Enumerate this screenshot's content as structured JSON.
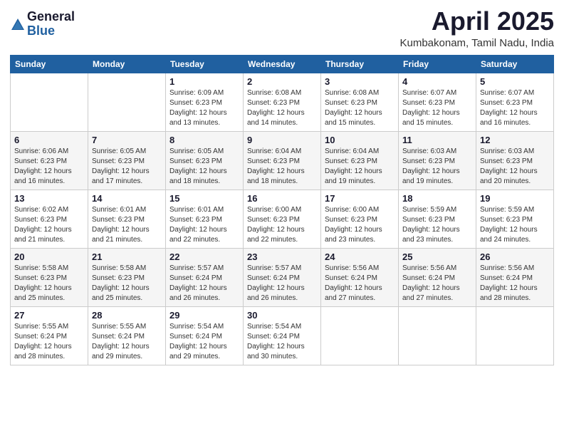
{
  "logo": {
    "general": "General",
    "blue": "Blue"
  },
  "title": "April 2025",
  "subtitle": "Kumbakonam, Tamil Nadu, India",
  "columns": [
    "Sunday",
    "Monday",
    "Tuesday",
    "Wednesday",
    "Thursday",
    "Friday",
    "Saturday"
  ],
  "weeks": [
    [
      {
        "day": "",
        "info": ""
      },
      {
        "day": "",
        "info": ""
      },
      {
        "day": "1",
        "info": "Sunrise: 6:09 AM\nSunset: 6:23 PM\nDaylight: 12 hours and 13 minutes."
      },
      {
        "day": "2",
        "info": "Sunrise: 6:08 AM\nSunset: 6:23 PM\nDaylight: 12 hours and 14 minutes."
      },
      {
        "day": "3",
        "info": "Sunrise: 6:08 AM\nSunset: 6:23 PM\nDaylight: 12 hours and 15 minutes."
      },
      {
        "day": "4",
        "info": "Sunrise: 6:07 AM\nSunset: 6:23 PM\nDaylight: 12 hours and 15 minutes."
      },
      {
        "day": "5",
        "info": "Sunrise: 6:07 AM\nSunset: 6:23 PM\nDaylight: 12 hours and 16 minutes."
      }
    ],
    [
      {
        "day": "6",
        "info": "Sunrise: 6:06 AM\nSunset: 6:23 PM\nDaylight: 12 hours and 16 minutes."
      },
      {
        "day": "7",
        "info": "Sunrise: 6:05 AM\nSunset: 6:23 PM\nDaylight: 12 hours and 17 minutes."
      },
      {
        "day": "8",
        "info": "Sunrise: 6:05 AM\nSunset: 6:23 PM\nDaylight: 12 hours and 18 minutes."
      },
      {
        "day": "9",
        "info": "Sunrise: 6:04 AM\nSunset: 6:23 PM\nDaylight: 12 hours and 18 minutes."
      },
      {
        "day": "10",
        "info": "Sunrise: 6:04 AM\nSunset: 6:23 PM\nDaylight: 12 hours and 19 minutes."
      },
      {
        "day": "11",
        "info": "Sunrise: 6:03 AM\nSunset: 6:23 PM\nDaylight: 12 hours and 19 minutes."
      },
      {
        "day": "12",
        "info": "Sunrise: 6:03 AM\nSunset: 6:23 PM\nDaylight: 12 hours and 20 minutes."
      }
    ],
    [
      {
        "day": "13",
        "info": "Sunrise: 6:02 AM\nSunset: 6:23 PM\nDaylight: 12 hours and 21 minutes."
      },
      {
        "day": "14",
        "info": "Sunrise: 6:01 AM\nSunset: 6:23 PM\nDaylight: 12 hours and 21 minutes."
      },
      {
        "day": "15",
        "info": "Sunrise: 6:01 AM\nSunset: 6:23 PM\nDaylight: 12 hours and 22 minutes."
      },
      {
        "day": "16",
        "info": "Sunrise: 6:00 AM\nSunset: 6:23 PM\nDaylight: 12 hours and 22 minutes."
      },
      {
        "day": "17",
        "info": "Sunrise: 6:00 AM\nSunset: 6:23 PM\nDaylight: 12 hours and 23 minutes."
      },
      {
        "day": "18",
        "info": "Sunrise: 5:59 AM\nSunset: 6:23 PM\nDaylight: 12 hours and 23 minutes."
      },
      {
        "day": "19",
        "info": "Sunrise: 5:59 AM\nSunset: 6:23 PM\nDaylight: 12 hours and 24 minutes."
      }
    ],
    [
      {
        "day": "20",
        "info": "Sunrise: 5:58 AM\nSunset: 6:23 PM\nDaylight: 12 hours and 25 minutes."
      },
      {
        "day": "21",
        "info": "Sunrise: 5:58 AM\nSunset: 6:23 PM\nDaylight: 12 hours and 25 minutes."
      },
      {
        "day": "22",
        "info": "Sunrise: 5:57 AM\nSunset: 6:24 PM\nDaylight: 12 hours and 26 minutes."
      },
      {
        "day": "23",
        "info": "Sunrise: 5:57 AM\nSunset: 6:24 PM\nDaylight: 12 hours and 26 minutes."
      },
      {
        "day": "24",
        "info": "Sunrise: 5:56 AM\nSunset: 6:24 PM\nDaylight: 12 hours and 27 minutes."
      },
      {
        "day": "25",
        "info": "Sunrise: 5:56 AM\nSunset: 6:24 PM\nDaylight: 12 hours and 27 minutes."
      },
      {
        "day": "26",
        "info": "Sunrise: 5:56 AM\nSunset: 6:24 PM\nDaylight: 12 hours and 28 minutes."
      }
    ],
    [
      {
        "day": "27",
        "info": "Sunrise: 5:55 AM\nSunset: 6:24 PM\nDaylight: 12 hours and 28 minutes."
      },
      {
        "day": "28",
        "info": "Sunrise: 5:55 AM\nSunset: 6:24 PM\nDaylight: 12 hours and 29 minutes."
      },
      {
        "day": "29",
        "info": "Sunrise: 5:54 AM\nSunset: 6:24 PM\nDaylight: 12 hours and 29 minutes."
      },
      {
        "day": "30",
        "info": "Sunrise: 5:54 AM\nSunset: 6:24 PM\nDaylight: 12 hours and 30 minutes."
      },
      {
        "day": "",
        "info": ""
      },
      {
        "day": "",
        "info": ""
      },
      {
        "day": "",
        "info": ""
      }
    ]
  ]
}
